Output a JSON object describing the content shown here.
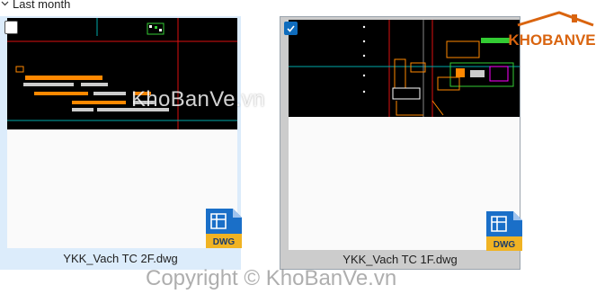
{
  "group": {
    "label": "Last month"
  },
  "files": [
    {
      "name": "YKK_Vach TC 2F.dwg",
      "selected": false,
      "type_label": "DWG"
    },
    {
      "name": "YKK_Vach TC 1F.dwg",
      "selected": true,
      "type_label": "DWG"
    }
  ],
  "watermark": {
    "center_text": "KhoBanVe.vn",
    "bottom_text": "Copyright © KhoBanVe.vn",
    "logo_text": "KHOBANVE"
  },
  "colors": {
    "selection_blue": "#0f6cbd",
    "tile_hover_bg": "#dcecfb",
    "tile_selected_bg": "#cccccc",
    "dwg_yellow": "#f0b323",
    "dwg_blue": "#1a6fc8",
    "logo_orange": "#d9640f"
  }
}
